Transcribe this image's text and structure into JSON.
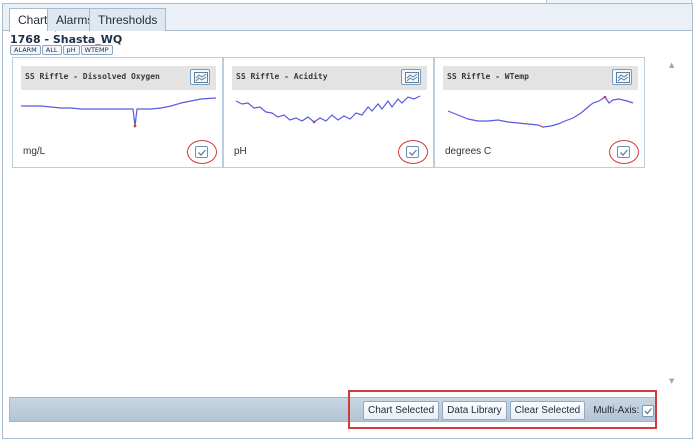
{
  "tabs": [
    {
      "label": "Chart",
      "active": true
    },
    {
      "label": "Alarms",
      "active": false
    },
    {
      "label": "Thresholds",
      "active": false
    }
  ],
  "station": {
    "title": "1768 - Shasta_WQ",
    "filters": [
      "ALARM",
      "ALL",
      "pH",
      "WTEMP"
    ]
  },
  "cards": [
    {
      "title": "SS Riffle - Dissolved Oxygen",
      "units": "mg/L",
      "checked": true,
      "chart_icon": "line-chart-icon"
    },
    {
      "title": "SS Riffle - Acidity",
      "units": "pH",
      "checked": true,
      "chart_icon": "line-chart-icon"
    },
    {
      "title": "SS Riffle - WTemp",
      "units": "degrees C",
      "checked": true,
      "chart_icon": "line-chart-icon"
    }
  ],
  "bottom": {
    "chart_selected": "Chart Selected",
    "data_library": "Data Library",
    "clear_selected": "Clear Selected",
    "multi_axis": "Multi-Axis:",
    "multi_axis_checked": true
  },
  "colors": {
    "accent": "#d23b3b",
    "sparkline": "#5b5be0",
    "border": "#a7bccf"
  }
}
